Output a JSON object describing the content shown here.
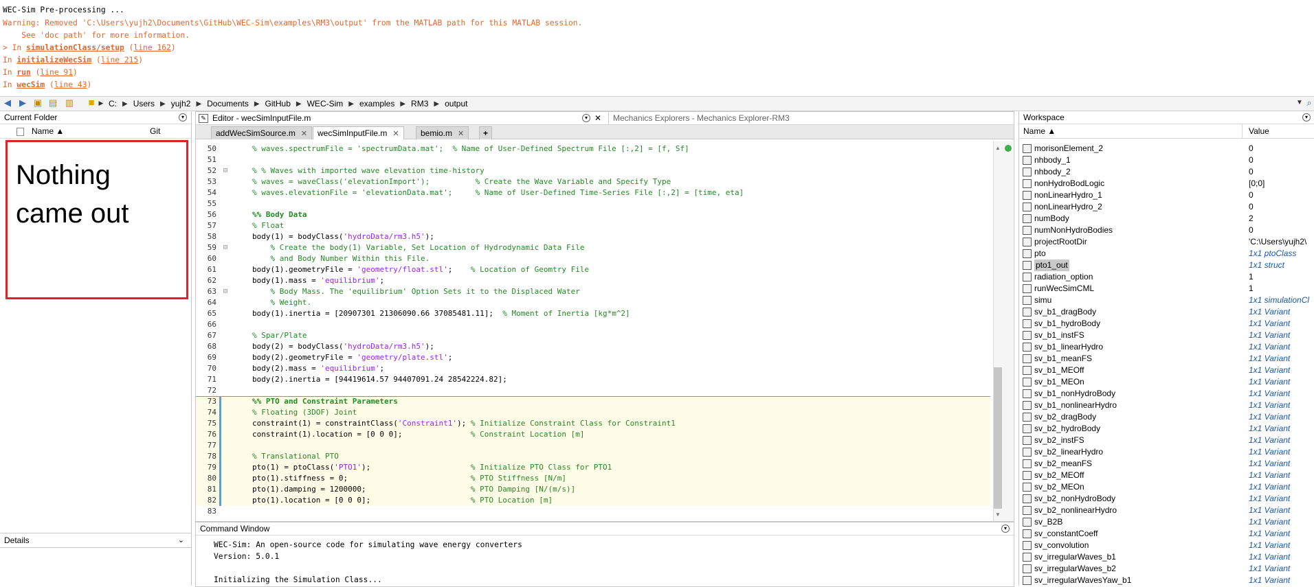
{
  "console_top": {
    "lines": [
      {
        "text": "WEC-Sim Pre-processing ...",
        "kind": "plain"
      },
      {
        "text": "Warning: Removed 'C:\\Users\\yujh2\\Documents\\GitHub\\WEC-Sim\\examples\\RM3\\output' from the MATLAB path for this MATLAB session.",
        "kind": "warn"
      },
      {
        "text": "    See 'doc path' for more information.",
        "kind": "warn"
      }
    ],
    "stack": [
      {
        "prefix": "> In ",
        "func": "simulationClass/setup",
        "line": "line 162"
      },
      {
        "prefix": "In ",
        "func": "initializeWecSim",
        "line": "line 215"
      },
      {
        "prefix": "In ",
        "func": "run",
        "line": "line 91"
      },
      {
        "prefix": "In ",
        "func": "wecSim",
        "line": "line 43"
      }
    ]
  },
  "address_bar": {
    "segments": [
      "C:",
      "Users",
      "yujh2",
      "Documents",
      "GitHub",
      "WEC-Sim",
      "examples",
      "RM3",
      "output"
    ]
  },
  "current_folder": {
    "title": "Current Folder",
    "col_name": "Name ▲",
    "col_git": "Git",
    "overlay_text_1": "Nothing",
    "overlay_text_2": "came out",
    "details_label": "Details"
  },
  "editor": {
    "title": "Editor - wecSimInputFile.m",
    "other_tab": "Mechanics Explorers - Mechanics Explorer-RM3",
    "tabs": [
      "addWecSimSource.m",
      "wecSimInputFile.m",
      "bemio.m"
    ],
    "active_tab": 1,
    "lines": [
      {
        "n": "50",
        "t": "% waves.spectrumFile = 'spectrumData.mat';  % Name of User-Defined Spectrum File [:,2] = [f, Sf]",
        "c": "cm"
      },
      {
        "n": "51",
        "t": "",
        "c": ""
      },
      {
        "n": "52",
        "t": "% % Waves with imported wave elevation time-history",
        "c": "cm",
        "fold": "⊟"
      },
      {
        "n": "53",
        "t": "% waves = waveClass('elevationImport');          % Create the Wave Variable and Specify Type",
        "c": "cm"
      },
      {
        "n": "54",
        "t": "% waves.elevationFile = 'elevationData.mat';     % Name of User-Defined Time-Series File [:,2] = [time, eta]",
        "c": "cm"
      },
      {
        "n": "55",
        "t": "",
        "c": ""
      },
      {
        "n": "56",
        "t": "%% Body Data",
        "c": "cm bold"
      },
      {
        "n": "57",
        "t": "% Float",
        "c": "cm"
      },
      {
        "n": "58",
        "t": "body(1) = bodyClass('hydroData/rm3.h5');",
        "c": "code",
        "str": "'hydroData/rm3.h5'"
      },
      {
        "n": "59",
        "t": "    % Create the body(1) Variable, Set Location of Hydrodynamic Data File",
        "c": "cm",
        "fold": "⊟"
      },
      {
        "n": "60",
        "t": "    % and Body Number Within this File.",
        "c": "cm"
      },
      {
        "n": "61",
        "t": "body(1).geometryFile = 'geometry/float.stl';    % Location of Geomtry File",
        "c": "code",
        "str": "'geometry/float.stl'",
        "cmt": "% Location of Geomtry File"
      },
      {
        "n": "62",
        "t": "body(1).mass = 'equilibrium';",
        "c": "code",
        "str": "'equilibrium'"
      },
      {
        "n": "63",
        "t": "    % Body Mass. The 'equilibrium' Option Sets it to the Displaced Water",
        "c": "cm",
        "fold": "⊟"
      },
      {
        "n": "64",
        "t": "    % Weight.",
        "c": "cm"
      },
      {
        "n": "65",
        "t": "body(1).inertia = [20907301 21306090.66 37085481.11];  % Moment of Inertia [kg*m^2]",
        "c": "code",
        "cmt": "% Moment of Inertia [kg*m^2]"
      },
      {
        "n": "66",
        "t": "",
        "c": ""
      },
      {
        "n": "67",
        "t": "% Spar/Plate",
        "c": "cm"
      },
      {
        "n": "68",
        "t": "body(2) = bodyClass('hydroData/rm3.h5');",
        "c": "code",
        "str": "'hydroData/rm3.h5'"
      },
      {
        "n": "69",
        "t": "body(2).geometryFile = 'geometry/plate.stl';",
        "c": "code",
        "str": "'geometry/plate.stl'"
      },
      {
        "n": "70",
        "t": "body(2).mass = 'equilibrium';",
        "c": "code",
        "str": "'equilibrium'"
      },
      {
        "n": "71",
        "t": "body(2).inertia = [94419614.57 94407091.24 28542224.82];",
        "c": "code"
      },
      {
        "n": "72",
        "t": "",
        "c": ""
      },
      {
        "n": "73",
        "t": "%% PTO and Constraint Parameters",
        "c": "cm bold",
        "cell": true
      },
      {
        "n": "74",
        "t": "% Floating (3DOF) Joint",
        "c": "cm",
        "cell": true
      },
      {
        "n": "75",
        "t": "constraint(1) = constraintClass('Constraint1'); % Initialize Constraint Class for Constraint1",
        "c": "code",
        "str": "'Constraint1'",
        "cmt": "% Initialize Constraint Class for Constraint1",
        "cell": true
      },
      {
        "n": "76",
        "t": "constraint(1).location = [0 0 0];               % Constraint Location [m]",
        "c": "code",
        "cmt": "% Constraint Location [m]",
        "cell": true
      },
      {
        "n": "77",
        "t": "",
        "c": "",
        "cell": true
      },
      {
        "n": "78",
        "t": "% Translational PTO",
        "c": "cm",
        "cell": true
      },
      {
        "n": "79",
        "t": "pto(1) = ptoClass('PTO1');                      % Initialize PTO Class for PTO1",
        "c": "code",
        "str": "'PTO1'",
        "cmt": "% Initialize PTO Class for PTO1",
        "cell": true
      },
      {
        "n": "80",
        "t": "pto(1).stiffness = 0;                           % PTO Stiffness [N/m]",
        "c": "code",
        "cmt": "% PTO Stiffness [N/m]",
        "cell": true
      },
      {
        "n": "81",
        "t": "pto(1).damping = 1200000;                       % PTO Damping [N/(m/s)]",
        "c": "code",
        "cmt": "% PTO Damping [N/(m/s)]",
        "cell": true
      },
      {
        "n": "82",
        "t": "pto(1).location = [0 0 0];                      % PTO Location [m]",
        "c": "code",
        "cmt": "% PTO Location [m]",
        "cell": true
      },
      {
        "n": "83",
        "t": "",
        "c": ""
      }
    ]
  },
  "command_window": {
    "title": "Command Window",
    "lines": [
      "WEC-Sim: An open-source code for simulating wave energy converters",
      "Version: 5.0.1",
      "",
      "Initializing the Simulation Class..."
    ]
  },
  "workspace": {
    "title": "Workspace",
    "col_name": "Name ▲",
    "col_value": "Value",
    "rows": [
      {
        "name": "morisonElement_2",
        "value": "0"
      },
      {
        "name": "nhbody_1",
        "value": "0"
      },
      {
        "name": "nhbody_2",
        "value": "0"
      },
      {
        "name": "nonHydroBodLogic",
        "value": "[0;0]"
      },
      {
        "name": "nonLinearHydro_1",
        "value": "0"
      },
      {
        "name": "nonLinearHydro_2",
        "value": "0"
      },
      {
        "name": "numBody",
        "value": "2"
      },
      {
        "name": "numNonHydroBodies",
        "value": "0"
      },
      {
        "name": "projectRootDir",
        "value": "'C:\\Users\\yujh2\\"
      },
      {
        "name": "pto",
        "value": "1x1 ptoClass",
        "italic": true
      },
      {
        "name": "pto1_out",
        "value": "1x1 struct",
        "italic": true,
        "selected": true
      },
      {
        "name": "radiation_option",
        "value": "1"
      },
      {
        "name": "runWecSimCML",
        "value": "1"
      },
      {
        "name": "simu",
        "value": "1x1 simulationCl",
        "italic": true
      },
      {
        "name": "sv_b1_dragBody",
        "value": "1x1 Variant",
        "italic": true
      },
      {
        "name": "sv_b1_hydroBody",
        "value": "1x1 Variant",
        "italic": true
      },
      {
        "name": "sv_b1_instFS",
        "value": "1x1 Variant",
        "italic": true
      },
      {
        "name": "sv_b1_linearHydro",
        "value": "1x1 Variant",
        "italic": true
      },
      {
        "name": "sv_b1_meanFS",
        "value": "1x1 Variant",
        "italic": true
      },
      {
        "name": "sv_b1_MEOff",
        "value": "1x1 Variant",
        "italic": true
      },
      {
        "name": "sv_b1_MEOn",
        "value": "1x1 Variant",
        "italic": true
      },
      {
        "name": "sv_b1_nonHydroBody",
        "value": "1x1 Variant",
        "italic": true
      },
      {
        "name": "sv_b1_nonlinearHydro",
        "value": "1x1 Variant",
        "italic": true
      },
      {
        "name": "sv_b2_dragBody",
        "value": "1x1 Variant",
        "italic": true
      },
      {
        "name": "sv_b2_hydroBody",
        "value": "1x1 Variant",
        "italic": true
      },
      {
        "name": "sv_b2_instFS",
        "value": "1x1 Variant",
        "italic": true
      },
      {
        "name": "sv_b2_linearHydro",
        "value": "1x1 Variant",
        "italic": true
      },
      {
        "name": "sv_b2_meanFS",
        "value": "1x1 Variant",
        "italic": true
      },
      {
        "name": "sv_b2_MEOff",
        "value": "1x1 Variant",
        "italic": true
      },
      {
        "name": "sv_b2_MEOn",
        "value": "1x1 Variant",
        "italic": true
      },
      {
        "name": "sv_b2_nonHydroBody",
        "value": "1x1 Variant",
        "italic": true
      },
      {
        "name": "sv_b2_nonlinearHydro",
        "value": "1x1 Variant",
        "italic": true
      },
      {
        "name": "sv_B2B",
        "value": "1x1 Variant",
        "italic": true
      },
      {
        "name": "sv_constantCoeff",
        "value": "1x1 Variant",
        "italic": true
      },
      {
        "name": "sv_convolution",
        "value": "1x1 Variant",
        "italic": true
      },
      {
        "name": "sv_irregularWaves_b1",
        "value": "1x1 Variant",
        "italic": true
      },
      {
        "name": "sv_irregularWaves_b2",
        "value": "1x1 Variant",
        "italic": true
      },
      {
        "name": "sv_irregularWavesYaw_b1",
        "value": "1x1 Variant",
        "italic": true
      }
    ]
  },
  "colors": {
    "warning": "#e5662b",
    "comment": "#228b22",
    "string": "#a020f0",
    "annotation_box": "#e0202a"
  }
}
